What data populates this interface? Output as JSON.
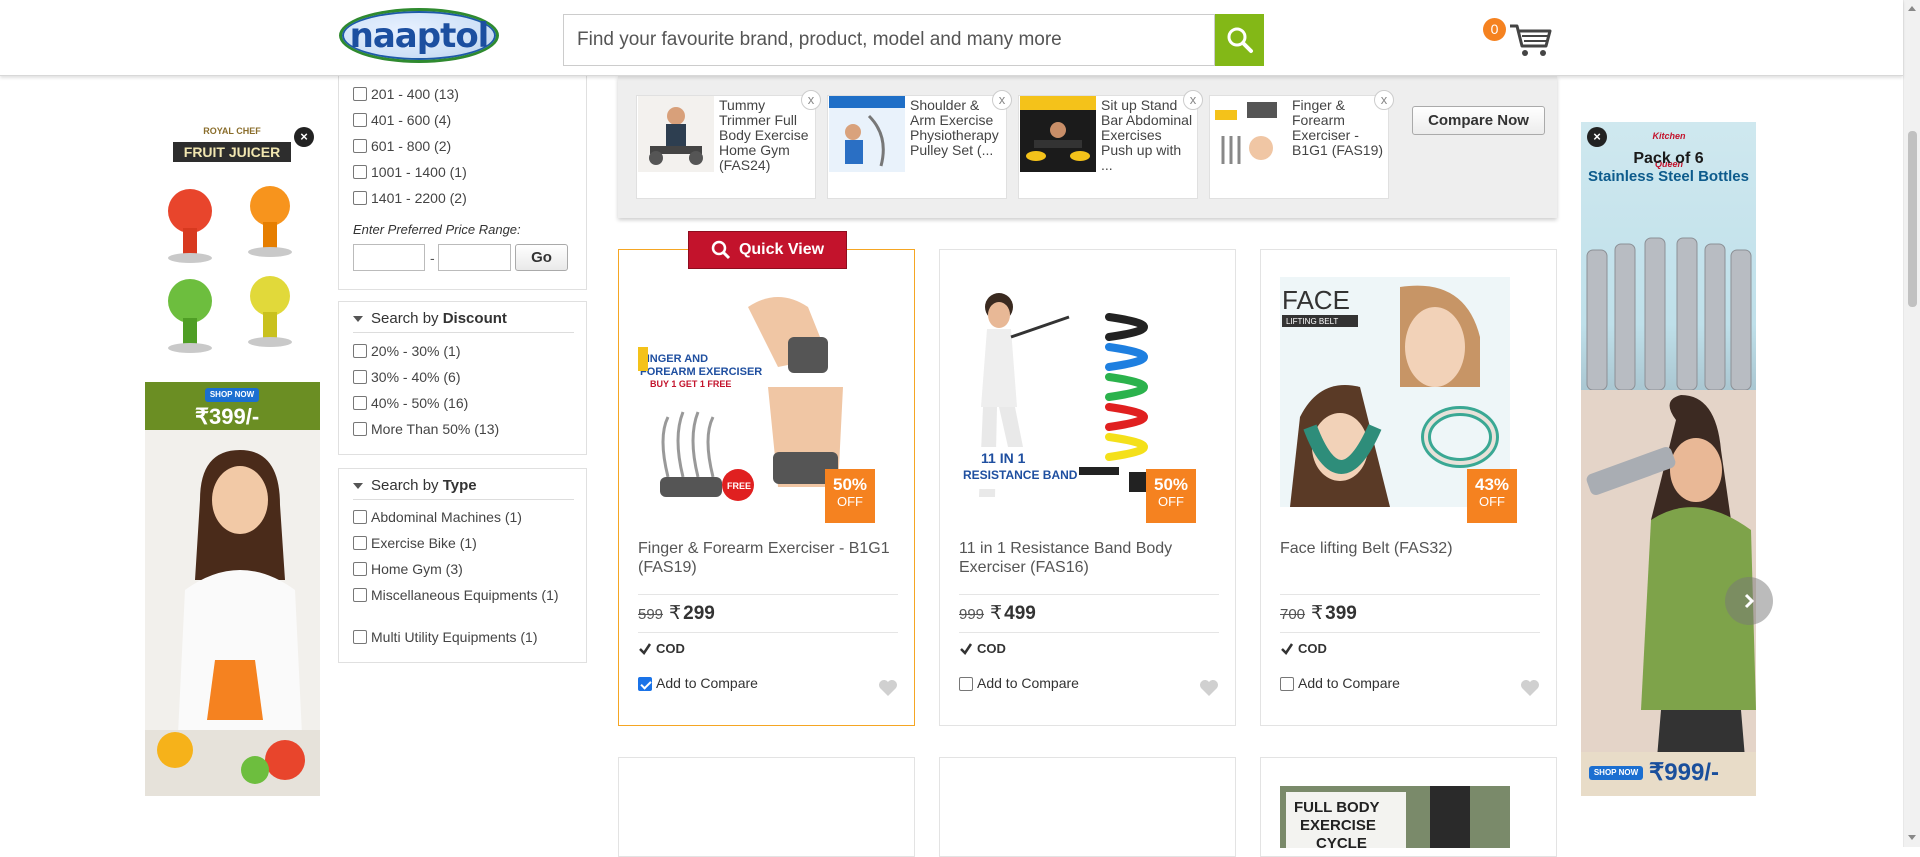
{
  "header": {
    "logo_text": "naaptol",
    "search_placeholder": "Find your favourite brand, product, model and many more",
    "cart_count": "0",
    "colors": {
      "search_button": "#83b817",
      "cart_badge": "#f58220"
    }
  },
  "filters": {
    "price_options": [
      "201 - 400 (13)",
      "401 - 600 (4)",
      "601 - 800 (2)",
      "1001 - 1400 (1)",
      "1401 - 2200 (2)"
    ],
    "price_range_label": "Enter Preferred Price Range:",
    "price_range_sep": "-",
    "go_label": "Go",
    "discount": {
      "title_prefix": "Search by ",
      "title_bold": "Discount",
      "options": [
        "20% - 30% (1)",
        "30% - 40% (6)",
        "40% - 50% (16)",
        "More Than 50% (13)"
      ]
    },
    "type": {
      "title_prefix": "Search by ",
      "title_bold": "Type",
      "options": [
        "Abdominal Machines (1)",
        "Exercise Bike (1)",
        "Home Gym (3)",
        "Miscellaneous Equipments (1)",
        "Multi Utility Equipments (1)"
      ]
    }
  },
  "compare": {
    "items": [
      {
        "name": "Tummy Trimmer Full Body Exercise Home Gym (FAS24)"
      },
      {
        "name": "Shoulder & Arm Exercise Physiotherapy Pulley Set (..."
      },
      {
        "name": "Sit up Stand Bar Abdominal Exercises Push up with ..."
      },
      {
        "name": "Finger & Forearm Exerciser - B1G1 (FAS19)"
      }
    ],
    "remove_icon": "x",
    "compare_now_label": "Compare Now"
  },
  "quick_view_label": "Quick View",
  "products": [
    {
      "title": "Finger & Forearm Exerciser - B1G1 (FAS19)",
      "mrp": "599",
      "price": "299",
      "discount_pct": "50%",
      "off_label": "OFF",
      "cod": "COD",
      "compare_label": "Add to Compare",
      "compare_checked": true,
      "image_text": "FINGER AND FOREARM EXERCISER",
      "image_sub": "BUY 1 GET 1 FREE"
    },
    {
      "title": "11 in 1 Resistance Band Body Exerciser (FAS16)",
      "mrp": "999",
      "price": "499",
      "discount_pct": "50%",
      "off_label": "OFF",
      "cod": "COD",
      "compare_label": "Add to Compare",
      "compare_checked": false,
      "image_text": "11 IN 1",
      "image_sub": "RESISTANCE BAND"
    },
    {
      "title": "Face lifting Belt (FAS32)",
      "mrp": "700",
      "price": "399",
      "discount_pct": "43%",
      "off_label": "OFF",
      "cod": "COD",
      "compare_label": "Add to Compare",
      "compare_checked": false,
      "image_text": "FACE",
      "image_sub": "LIFTING BELT"
    }
  ],
  "bottom_cards": {
    "cycle_text": "FULL BODY EXERCISE CYCLE"
  },
  "currency_symbol": "₹",
  "ads": {
    "left": {
      "brand": "ROYAL CHEF",
      "title": "FRUIT JUICER",
      "cta": "SHOP NOW",
      "price": "₹399/-"
    },
    "right": {
      "brand": "Kitchen Queen",
      "title_line1": "Pack of 6",
      "title_line2": "Stainless Steel Bottles",
      "cta": "SHOP NOW",
      "price": "₹999/-"
    },
    "close_icon": "×"
  },
  "icons": {
    "search": "search-icon",
    "cart": "cart-icon",
    "heart": "heart-icon",
    "check": "check-icon",
    "magnifier": "magnifier-icon",
    "chevron": "chevron-right-icon"
  }
}
